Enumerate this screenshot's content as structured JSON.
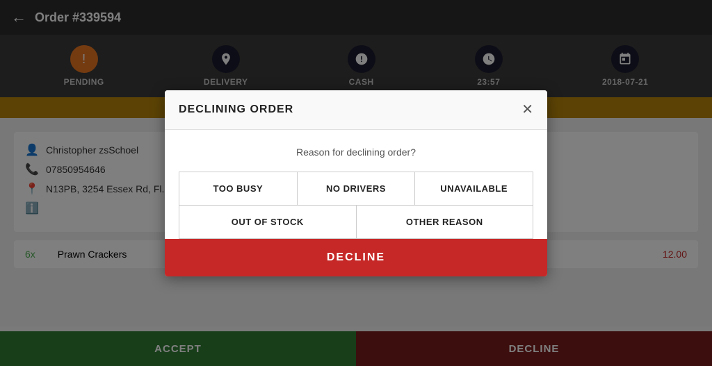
{
  "header": {
    "title": "Order #339594",
    "back_label": "←"
  },
  "status_bar": {
    "items": [
      {
        "id": "pending",
        "label": "PENDING",
        "icon": "!",
        "icon_style": "orange"
      },
      {
        "id": "delivery",
        "label": "DELIVERY",
        "icon": "📍",
        "icon_style": "dark"
      },
      {
        "id": "cash",
        "label": "CASH",
        "icon": "$",
        "icon_style": "dark"
      },
      {
        "id": "time",
        "label": "23:57",
        "icon": "🕐",
        "icon_style": "dark"
      },
      {
        "id": "date",
        "label": "2018-07-21",
        "icon": "📅",
        "icon_style": "dark"
      }
    ]
  },
  "customer": {
    "name": "Christopher zsSchoel",
    "phone": "07850954646",
    "address": "N13PB, 3254 Essex Rd, Fl..."
  },
  "order_items": [
    {
      "qty": "6x",
      "name": "Prawn Crackers",
      "price": "12.00"
    }
  ],
  "action_bar": {
    "accept_label": "ACCEPT",
    "decline_label": "DECLINE"
  },
  "modal": {
    "title": "DECLINING ORDER",
    "reason_prompt": "Reason for declining order?",
    "close_label": "✕",
    "reasons_row1": [
      {
        "id": "too-busy",
        "label": "TOO BUSY"
      },
      {
        "id": "no-drivers",
        "label": "NO DRIVERS"
      },
      {
        "id": "unavailable",
        "label": "UNAVAILABLE"
      }
    ],
    "reasons_row2": [
      {
        "id": "out-of-stock",
        "label": "OUT OF STOCK"
      },
      {
        "id": "other-reason",
        "label": "OTHER REASON"
      }
    ],
    "decline_label": "DECLINE"
  }
}
